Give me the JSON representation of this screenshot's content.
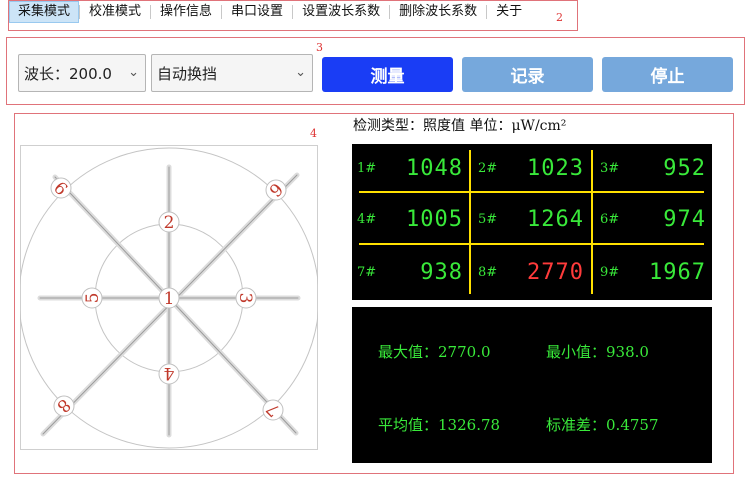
{
  "menu": {
    "items": [
      "采集模式",
      "校准模式",
      "操作信息",
      "串口设置",
      "设置波长系数",
      "删除波长系数",
      "关于"
    ],
    "marker": "2"
  },
  "toolbar": {
    "marker": "3",
    "wavelength_select": "波长：200.0",
    "range_select": "自动换挡",
    "measure_label": "测量",
    "record_label": "记录",
    "stop_label": "停止"
  },
  "panel": {
    "marker": "4",
    "info": {
      "type_label": "检测类型：",
      "type_value": "照度值",
      "unit_label": "单位：",
      "unit_value": "μW/cm²"
    },
    "diagram_points": [
      "1",
      "2",
      "3",
      "4",
      "5",
      "6",
      "7",
      "8",
      "9"
    ],
    "cells": [
      {
        "label": "1#",
        "value": "1048",
        "color": "#39e93a"
      },
      {
        "label": "2#",
        "value": "1023",
        "color": "#39e93a"
      },
      {
        "label": "3#",
        "value": "952",
        "color": "#39e93a"
      },
      {
        "label": "4#",
        "value": "1005",
        "color": "#39e93a"
      },
      {
        "label": "5#",
        "value": "1264",
        "color": "#39e93a"
      },
      {
        "label": "6#",
        "value": "974",
        "color": "#39e93a"
      },
      {
        "label": "7#",
        "value": "938",
        "color": "#39e93a"
      },
      {
        "label": "8#",
        "value": "2770",
        "color": "#ff3b3b"
      },
      {
        "label": "9#",
        "value": "1967",
        "color": "#39e93a"
      }
    ],
    "stats": {
      "max_label": "最大值：",
      "max_value": "2770.0",
      "min_label": "最小值：",
      "min_value": "938.0",
      "avg_label": "平均值：",
      "avg_value": "1326.78",
      "std_label": "标准差：",
      "std_value": "0.4757"
    }
  },
  "colors": {
    "measure_button": "#1a3df5",
    "disabled_button": "#76a8dc",
    "grid_lines": "#ffe000",
    "digit_green": "#39e93a",
    "digit_red": "#ff3b3b"
  }
}
